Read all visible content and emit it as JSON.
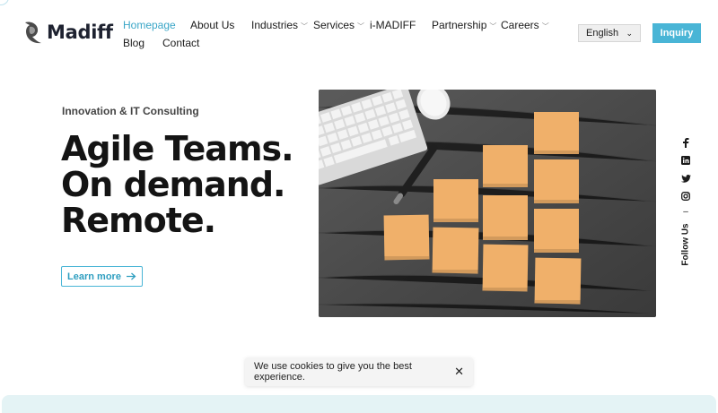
{
  "brand": {
    "name": "Madiff"
  },
  "nav": {
    "items": [
      {
        "label": "Homepage",
        "active": true
      },
      {
        "label": "About Us"
      },
      {
        "label": "Industries",
        "has_dropdown": true
      },
      {
        "label": "Services",
        "has_dropdown": true
      },
      {
        "label": "i-MADIFF"
      },
      {
        "label": "Partnership",
        "has_dropdown": true
      },
      {
        "label": "Careers",
        "has_dropdown": true
      },
      {
        "label": "Blog"
      },
      {
        "label": "Contact"
      }
    ]
  },
  "language": {
    "selected": "English"
  },
  "header": {
    "inquiry_label": "Inquiry"
  },
  "hero": {
    "eyebrow": "Innovation & IT Consulting",
    "headline": [
      "Agile Teams.",
      "On demand.",
      "Remote."
    ],
    "cta_label": "Learn more"
  },
  "social": {
    "icons": [
      "facebook-icon",
      "linkedin-icon",
      "twitter-icon",
      "instagram-icon"
    ],
    "follow_label": "Follow Us"
  },
  "cookie": {
    "message": "We use cookies to give you the best experience."
  },
  "colors": {
    "accent": "#49b5d6",
    "active_nav": "#3aa6c7",
    "text": "#1b1b1b"
  }
}
